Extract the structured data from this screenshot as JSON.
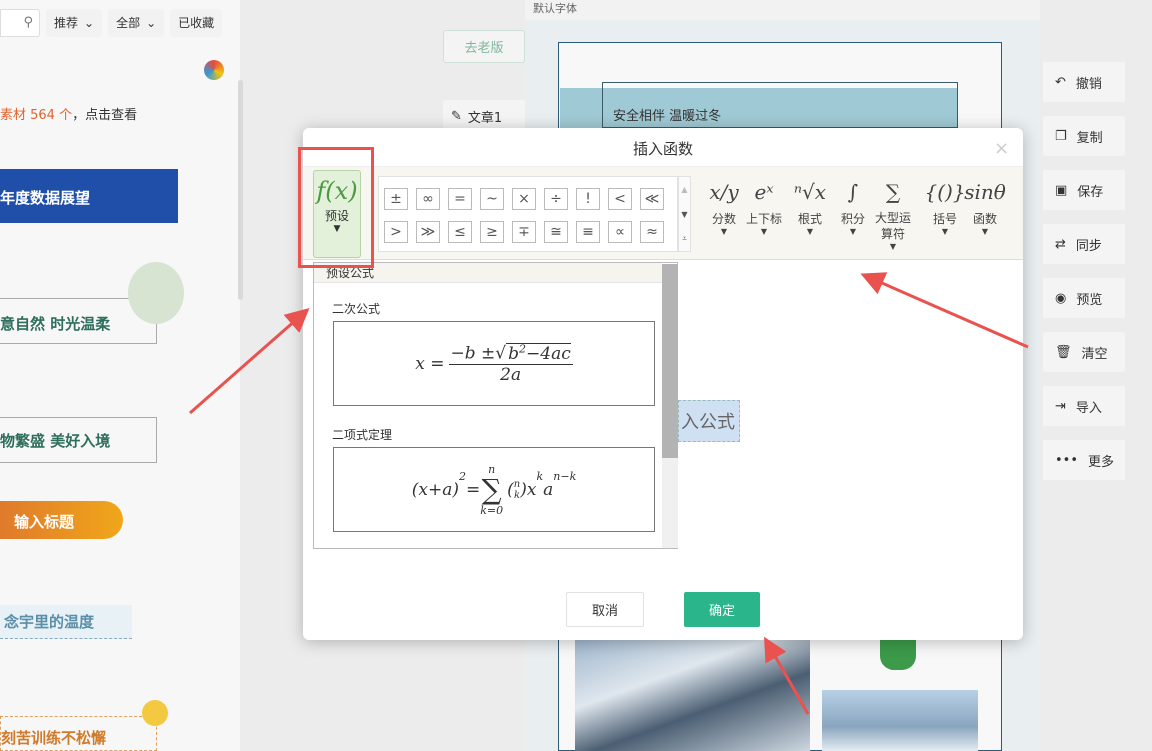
{
  "left_panel": {
    "tabs": [
      "推荐",
      "全部",
      "已收藏"
    ],
    "material_notice": {
      "highlight": "素材 564 个",
      "suffix": "，点击查看"
    },
    "templates": [
      "年度数据展望",
      "意自然 时光温柔",
      "物繁盛 美好入境",
      "输入标题",
      "念宇里的温度",
      "刻苦训练不松懈"
    ]
  },
  "middle": {
    "old_version": "去老版",
    "doc_tab": "文章1"
  },
  "editor": {
    "font_select": "默认字体",
    "banner_text": "安全相伴 温暖过冬",
    "placeholder_text": "入公式"
  },
  "right_sidebar": [
    {
      "icon": "undo-icon",
      "glyph": "↶",
      "label": "撤销"
    },
    {
      "icon": "copy-icon",
      "glyph": "❐",
      "label": "复制"
    },
    {
      "icon": "save-icon",
      "glyph": "▣",
      "label": "保存"
    },
    {
      "icon": "sync-icon",
      "glyph": "⇄",
      "label": "同步"
    },
    {
      "icon": "eye-icon",
      "glyph": "◉",
      "label": "预览"
    },
    {
      "icon": "trash-icon",
      "glyph": "🗑",
      "label": "清空"
    },
    {
      "icon": "import-icon",
      "glyph": "⇥",
      "label": "导入"
    },
    {
      "icon": "more-icon",
      "glyph": "•••",
      "label": "更多"
    }
  ],
  "dialog": {
    "title": "插入函数",
    "close": "×",
    "preset": {
      "glyph": "f(x)",
      "label": "预设"
    },
    "symbols": [
      "±",
      "∞",
      "=",
      "~",
      "×",
      "÷",
      "!",
      "<",
      "≪",
      ">",
      "≫",
      "≤",
      "≥",
      "∓",
      "≅",
      "≡",
      "∝",
      "≈"
    ],
    "templates": [
      {
        "glyph": "x/y",
        "label": "分数"
      },
      {
        "glyph": "eˣ",
        "label": "上下标"
      },
      {
        "glyph": "ⁿ√x",
        "label": "根式"
      },
      {
        "glyph": "∫",
        "label": "积分"
      },
      {
        "glyph": "∑",
        "label": "大型运算符"
      },
      {
        "glyph": "{()}",
        "label": "括号"
      },
      {
        "glyph": "sinθ",
        "label": "函数"
      }
    ],
    "panel_header": "预设公式",
    "formulas": [
      {
        "name": "二次公式",
        "lhs": "x =",
        "num_pre": "−b ±",
        "rad_base": "b",
        "rad_exp": "2",
        "rad_rest": "−4ac",
        "den": "2a"
      },
      {
        "name": "二项式定理",
        "lhs": "(x+a)",
        "lhs_exp": "2",
        "eq": "=",
        "sum": "∑",
        "sum_top": "n",
        "sum_bottom": "k=0",
        "binom_top": "n",
        "binom_bottom": "k",
        "t1": "x",
        "t1_exp": "k",
        "t2": "a",
        "t2_exp": "n−k"
      }
    ],
    "cancel": "取消",
    "confirm": "确定"
  },
  "colors": {
    "accent": "#2bb58a",
    "annotation": "#e9524f",
    "preset_green": "#4a9a3f"
  }
}
